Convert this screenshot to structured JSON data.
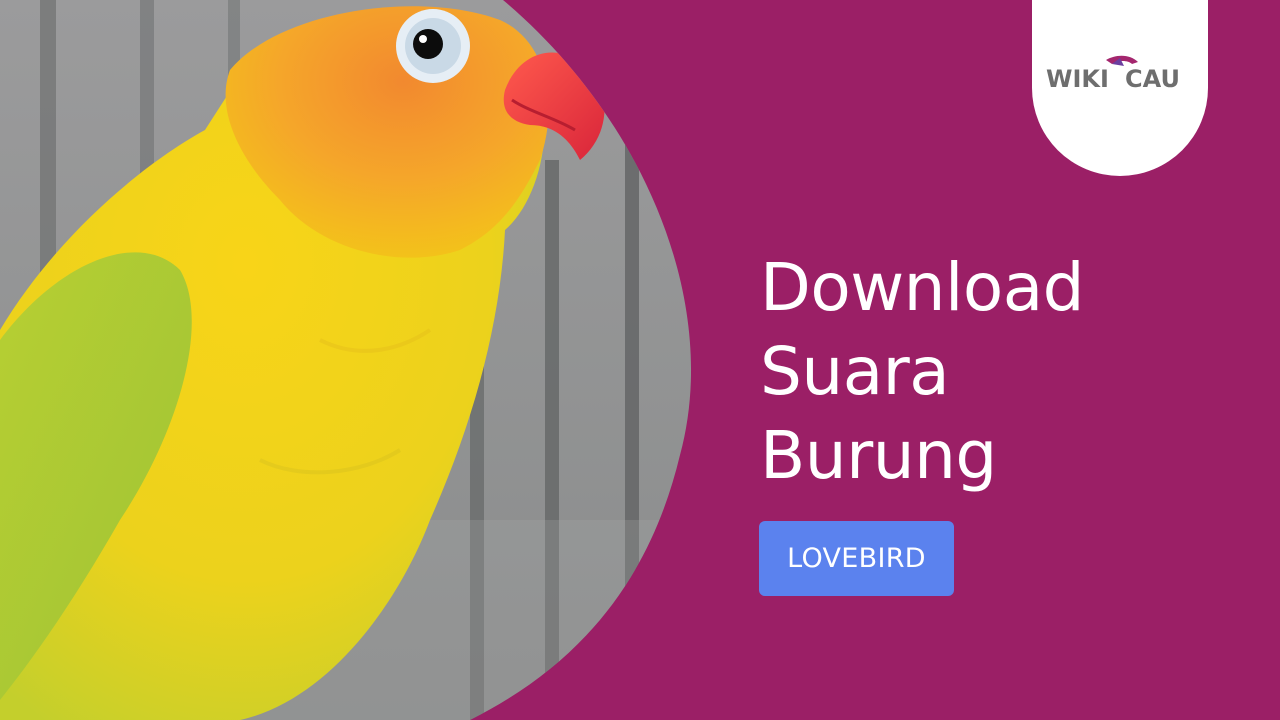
{
  "brand": {
    "logo_text_left": "WIKI",
    "logo_text_right": "CAU"
  },
  "headline": {
    "line1": "Download",
    "line2": "Suara",
    "line3": "Burung"
  },
  "tag": {
    "label": "LOVEBIRD"
  },
  "colors": {
    "background": "#9b1f66",
    "tag_background": "#5b82ee",
    "logo_grey": "#6e6e6e",
    "logo_accent": "#a4266e"
  },
  "photo": {
    "subject": "lovebird-parrot"
  }
}
